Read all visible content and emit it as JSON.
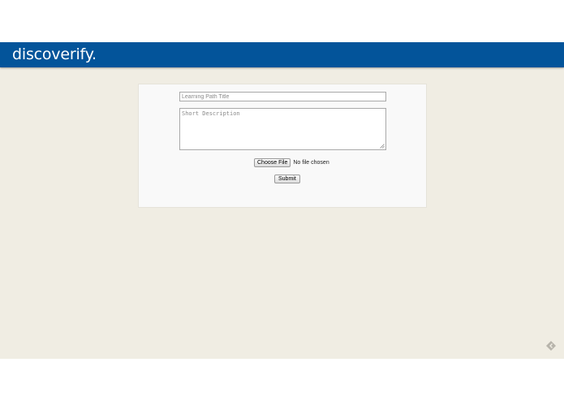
{
  "navbar": {
    "brand": "discoverify."
  },
  "form": {
    "title_placeholder": "Learning Path Title",
    "title_value": "",
    "description_placeholder": "Short Description",
    "description_value": "",
    "choose_file_label": "Choose File",
    "file_status": "No file chosen",
    "submit_label": "Submit"
  },
  "icons": {
    "nav_arrow": "diamond-arrow-icon"
  },
  "colors": {
    "navbar": "#03549a",
    "page_background": "#f0ede3",
    "card_background": "#f9f9f9",
    "brand_text": "#ffffff"
  }
}
